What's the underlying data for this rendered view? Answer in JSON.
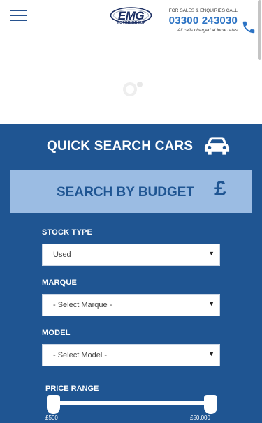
{
  "header": {
    "logo_text": "EMG",
    "logo_sub": "MOTOR GROUP",
    "contact_label": "FOR SALES & ENQUIRIES CALL",
    "phone": "03300 243030",
    "note": "All calls charged at local rates",
    "accent_color": "#2c73c4",
    "icons": [
      "menu-icon",
      "phone-icon"
    ]
  },
  "quick_search": {
    "title": "QUICK SEARCH CARS",
    "icon": "car-icon",
    "budget_label": "SEARCH BY BUDGET",
    "budget_icon": "pound-icon",
    "panel_color": "#1f5592",
    "budget_color": "#9bbce3"
  },
  "form": {
    "stock_type": {
      "label": "STOCK TYPE",
      "value": "Used"
    },
    "marque": {
      "label": "MARQUE",
      "value": "- Select Marque -"
    },
    "model": {
      "label": "MODEL",
      "value": "- Select Model -"
    },
    "price_range": {
      "label": "PRICE RANGE",
      "min": "£500",
      "max": "£50,000"
    }
  }
}
